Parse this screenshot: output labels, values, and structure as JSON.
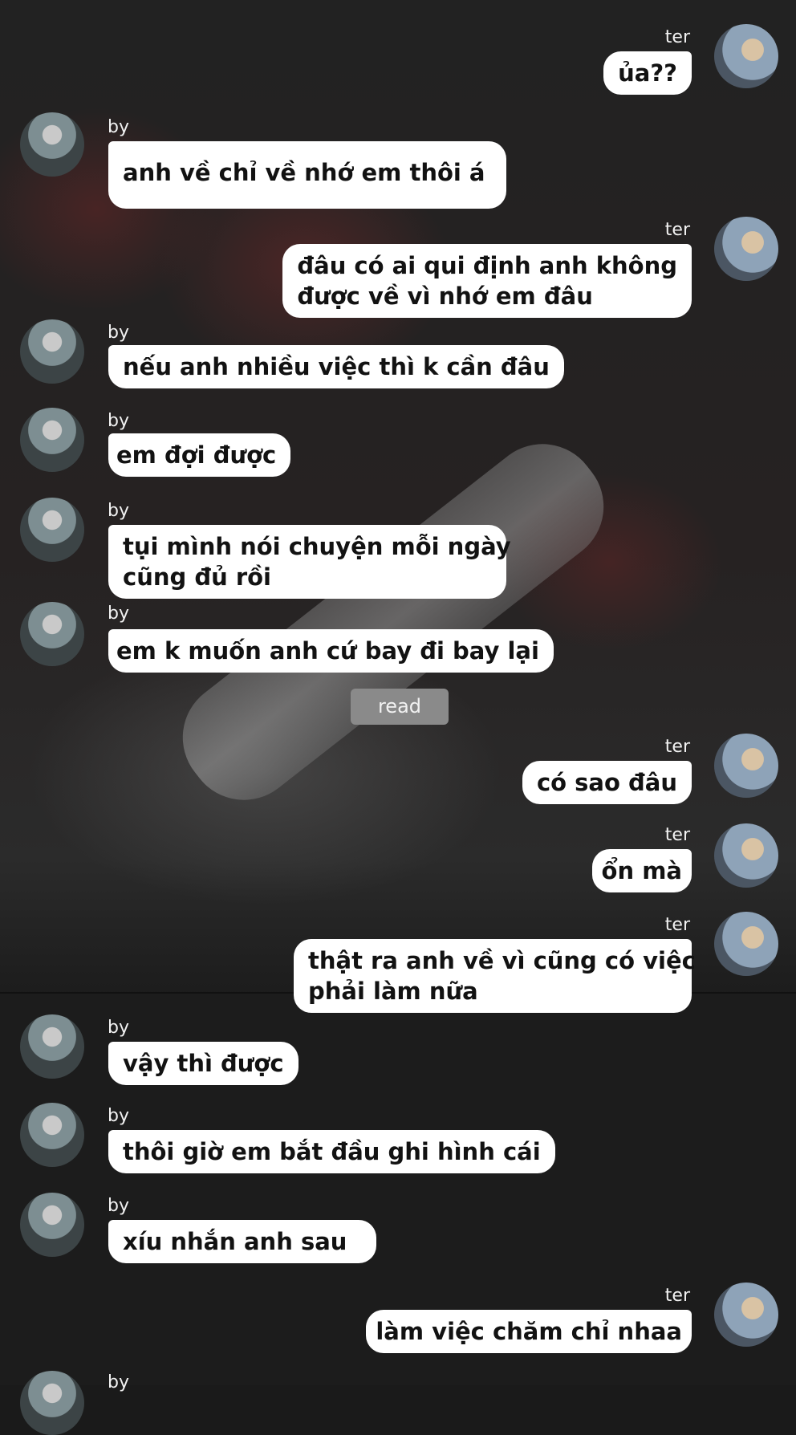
{
  "participants": {
    "by": "by",
    "ter": "ter"
  },
  "messages": [
    {
      "sender": "ter",
      "text": "ủa??"
    },
    {
      "sender": "by",
      "text": "anh về chỉ về nhớ em thôi á"
    },
    {
      "sender": "ter",
      "text": "đâu có ai qui định anh không được về vì nhớ em đâu",
      "lines": [
        "đâu có ai qui định anh không",
        "được về vì nhớ em đâu"
      ]
    },
    {
      "sender": "by",
      "text": "nếu anh nhiều việc thì k cần đâu"
    },
    {
      "sender": "by",
      "text": "em đợi được"
    },
    {
      "sender": "by",
      "text": "tụi mình nói chuyện mỗi ngày cũng đủ rồi",
      "lines": [
        "tụi mình nói chuyện mỗi ngày",
        "cũng đủ rồi"
      ]
    },
    {
      "sender": "by",
      "text": "em k muốn anh cứ bay đi bay lại"
    },
    {
      "sender": "ter",
      "text": "có sao đâu"
    },
    {
      "sender": "ter",
      "text": "ổn mà"
    },
    {
      "sender": "ter",
      "text": "thật ra anh về vì cũng có việc phải làm nữa",
      "lines": [
        "thật ra anh về vì cũng có việc",
        "phải làm nữa"
      ]
    },
    {
      "sender": "by",
      "text": "vậy thì được"
    },
    {
      "sender": "by",
      "text": "thôi giờ em bắt đầu ghi hình cái"
    },
    {
      "sender": "by",
      "text": "xíu nhắn anh sau"
    },
    {
      "sender": "ter",
      "text": "làm việc chăm chỉ nhaa"
    }
  ],
  "read_label": "read",
  "icons": {
    "avatar_by": "avatar-by-photo",
    "avatar_ter": "avatar-ter-photo"
  }
}
